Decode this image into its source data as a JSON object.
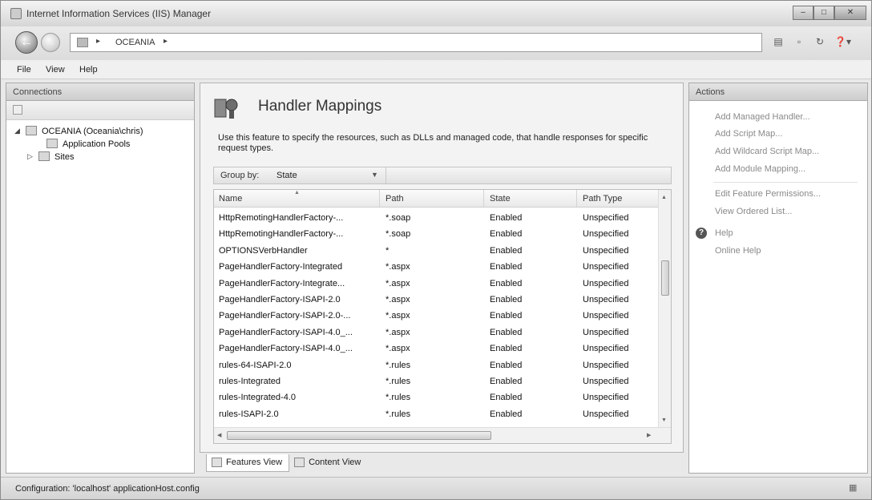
{
  "window": {
    "title": "Internet Information Services (IIS) Manager"
  },
  "address": {
    "path": "OCEANIA"
  },
  "menu": [
    "File",
    "View",
    "Help"
  ],
  "connections": {
    "header": "Connections",
    "tree": [
      {
        "label": "OCEANIA (Oceania\\chris)"
      },
      {
        "label": "Application Pools"
      },
      {
        "label": "Sites"
      }
    ]
  },
  "feature": {
    "title": "Handler Mappings",
    "description": "Use this feature to specify the resources, such as DLLs and managed code, that handle responses for specific request types.",
    "group_by_label": "Group by:",
    "group_by_value": "State"
  },
  "grid": {
    "columns": [
      "Name",
      "Path",
      "State",
      "Path Type"
    ],
    "rows": [
      [
        "HttpRemotingHandlerFactory-...",
        "*.soap",
        "Enabled",
        "Unspecified"
      ],
      [
        "HttpRemotingHandlerFactory-...",
        "*.soap",
        "Enabled",
        "Unspecified"
      ],
      [
        "OPTIONSVerbHandler",
        "*",
        "Enabled",
        "Unspecified"
      ],
      [
        "PageHandlerFactory-Integrated",
        "*.aspx",
        "Enabled",
        "Unspecified"
      ],
      [
        "PageHandlerFactory-Integrate...",
        "*.aspx",
        "Enabled",
        "Unspecified"
      ],
      [
        "PageHandlerFactory-ISAPI-2.0",
        "*.aspx",
        "Enabled",
        "Unspecified"
      ],
      [
        "PageHandlerFactory-ISAPI-2.0-...",
        "*.aspx",
        "Enabled",
        "Unspecified"
      ],
      [
        "PageHandlerFactory-ISAPI-4.0_...",
        "*.aspx",
        "Enabled",
        "Unspecified"
      ],
      [
        "PageHandlerFactory-ISAPI-4.0_...",
        "*.aspx",
        "Enabled",
        "Unspecified"
      ],
      [
        "rules-64-ISAPI-2.0",
        "*.rules",
        "Enabled",
        "Unspecified"
      ],
      [
        "rules-Integrated",
        "*.rules",
        "Enabled",
        "Unspecified"
      ],
      [
        "rules-Integrated-4.0",
        "*.rules",
        "Enabled",
        "Unspecified"
      ],
      [
        "rules-ISAPI-2.0",
        "*.rules",
        "Enabled",
        "Unspecified"
      ]
    ]
  },
  "view_tabs": [
    "Features View",
    "Content View"
  ],
  "actions": {
    "header": "Actions",
    "group1": [
      "Add Managed Handler...",
      "Add Script Map...",
      "Add Wildcard Script Map...",
      "Add Module Mapping..."
    ],
    "group2": [
      "Edit Feature Permissions...",
      "View Ordered List..."
    ],
    "help": [
      "Help",
      "Online Help"
    ]
  },
  "status": {
    "text": "Configuration: 'localhost' applicationHost.config"
  }
}
